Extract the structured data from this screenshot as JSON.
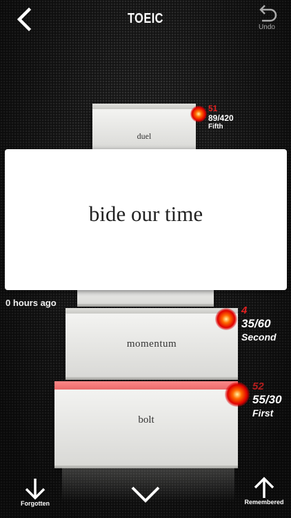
{
  "header": {
    "title": "TOEIC",
    "undo_label": "Undo"
  },
  "main_card": {
    "word": "bide our time"
  },
  "cards": [
    {
      "word": "duel",
      "count": "51",
      "progress": "89/420",
      "stage": "Fifth"
    },
    {
      "word": "momentum",
      "count": "4",
      "progress": "35/60",
      "stage": "Second"
    },
    {
      "word": "bolt",
      "count": "52",
      "progress": "55/30",
      "stage": "First"
    }
  ],
  "time_ago": "0 hours ago",
  "footer": {
    "forgotten_label": "Forgotten",
    "remembered_label": "Remembered"
  },
  "colors": {
    "accent_red": "#e02020",
    "highlight_card": "#ff8888"
  }
}
